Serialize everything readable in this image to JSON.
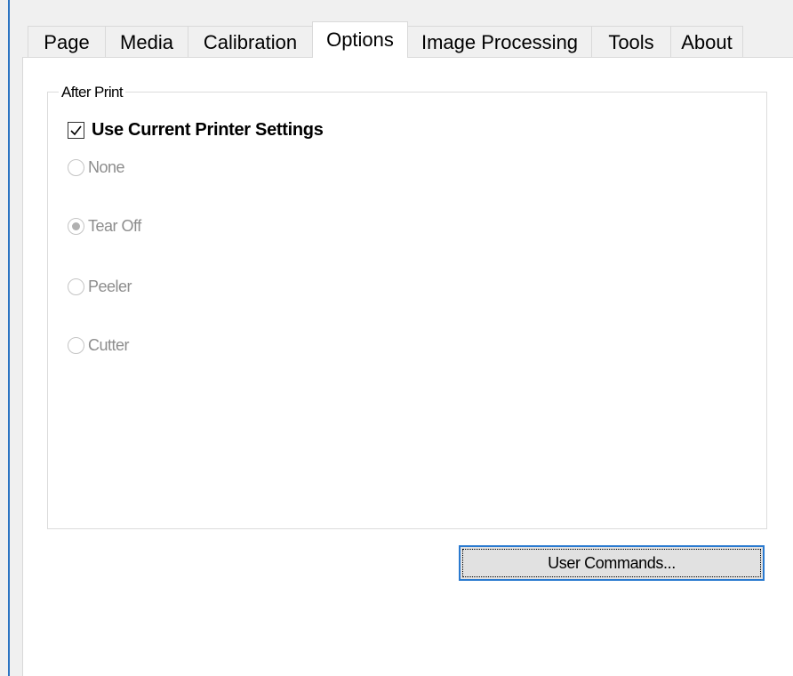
{
  "tabs": [
    {
      "label": "Page"
    },
    {
      "label": "Media"
    },
    {
      "label": "Calibration"
    },
    {
      "label": "Options",
      "active": true
    },
    {
      "label": "Image Processing"
    },
    {
      "label": "Tools"
    },
    {
      "label": "About"
    }
  ],
  "after_print": {
    "legend": "After Print",
    "use_current": {
      "label": "Use Current Printer Settings",
      "checked": true
    },
    "options": [
      {
        "label": "None",
        "selected": false,
        "enabled": false
      },
      {
        "label": "Tear Off",
        "selected": true,
        "enabled": false
      },
      {
        "label": "Peeler",
        "selected": false,
        "enabled": false
      },
      {
        "label": "Cutter",
        "selected": false,
        "enabled": false
      }
    ]
  },
  "user_commands_button": {
    "label": "User Commands..."
  },
  "colors": {
    "focus_border": "#2a7ad0",
    "disabled_text": "#8d8d8d",
    "window_edge": "#2b74c2"
  },
  "icons": {
    "checkbox": "check-mark-icon",
    "radio": "radio-dot-icon"
  }
}
